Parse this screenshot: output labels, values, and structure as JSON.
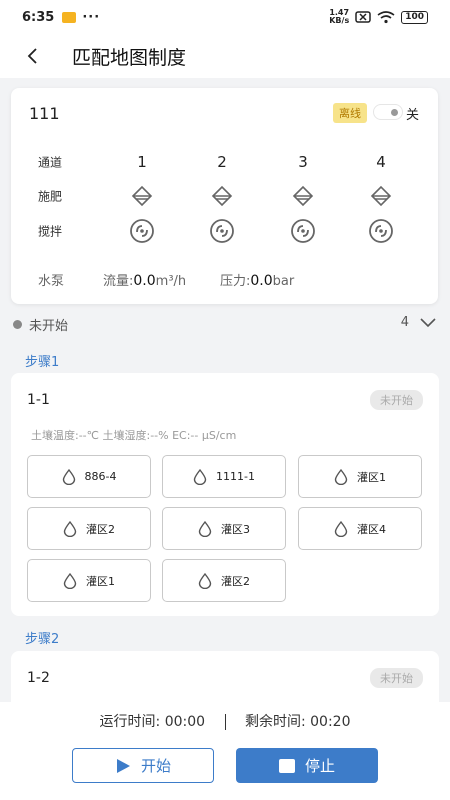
{
  "status_bar": {
    "time": "6:35",
    "dots": "···",
    "speed_top": "1.47",
    "speed_bottom": "KB/s",
    "battery": "100"
  },
  "nav": {
    "title": "匹配地图制度"
  },
  "device": {
    "name": "111",
    "state_badge": "离线",
    "toggle_label": "关",
    "channel_label": "通道",
    "channels": [
      "1",
      "2",
      "3",
      "4"
    ],
    "fertilize_label": "施肥",
    "stir_label": "搅拌",
    "pump_label": "水泵",
    "flow_label": "流量:",
    "flow_value": "0.0",
    "flow_unit": "m³/h",
    "pressure_label": "压力:",
    "pressure_value": "0.0",
    "pressure_unit": "bar"
  },
  "run_status": {
    "text": "未开始",
    "count": "4"
  },
  "steps": [
    {
      "title": "步骤1",
      "id": "1-1",
      "badge": "未开始",
      "sensor": "土壤温度:--℃   土壤湿度:--%   EC:-- μS/cm",
      "zones": [
        "886-4",
        "1111-1",
        "灌区1",
        "灌区2",
        "灌区3",
        "灌区4",
        "灌区1",
        "灌区2"
      ]
    },
    {
      "title": "步骤2",
      "id": "1-2",
      "badge": "未开始"
    }
  ],
  "bottom": {
    "run_time_label": "运行时间:",
    "run_time": "00:00",
    "remain_label": "剩余时间:",
    "remain_time": "00:20",
    "start_label": "开始",
    "stop_label": "停止"
  },
  "colors": {
    "primary": "#3d7cc9",
    "offline_bg": "#f7e38a"
  }
}
